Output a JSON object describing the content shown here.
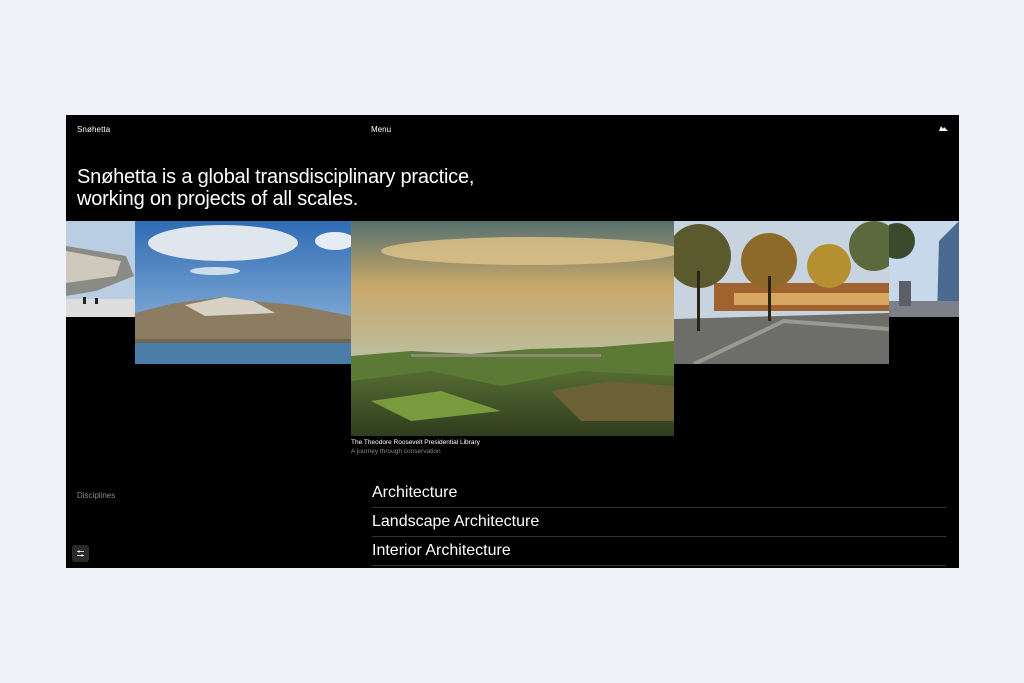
{
  "header": {
    "logo": "Snøhetta",
    "menu_label": "Menu",
    "brand_icon": "snohetta-mark-icon"
  },
  "hero": {
    "headline": "Snøhetta is a global transdisciplinary practice, working on projects of all scales."
  },
  "featured": {
    "title": "The Theodore Roosevelt Presidential Library",
    "subtitle": "A journey through conservation"
  },
  "disciplines": {
    "label": "Disciplines",
    "items": [
      "Architecture",
      "Landscape Architecture",
      "Interior Architecture"
    ]
  },
  "filter_icon": "sliders-icon"
}
